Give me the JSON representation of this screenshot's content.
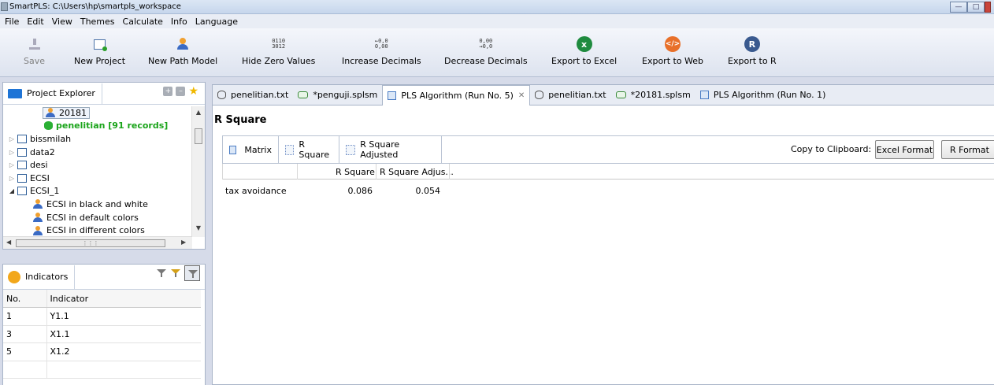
{
  "window": {
    "title": "SmartPLS: C:\\Users\\hp\\smartpls_workspace"
  },
  "menu": [
    "File",
    "Edit",
    "View",
    "Themes",
    "Calculate",
    "Info",
    "Language"
  ],
  "toolbar": {
    "save": "Save",
    "new_project": "New Project",
    "new_path_model": "New Path Model",
    "hide_zero": "Hide Zero Values",
    "hide_zero_glyph": "0110\n3012",
    "increase_decimals": "Increase Decimals",
    "increase_glyph": "←0,0\n0,00",
    "decrease_decimals": "Decrease Decimals",
    "decrease_glyph": "0,00\n→0,0",
    "export_excel": "Export to Excel",
    "export_web": "Export to Web",
    "export_r": "Export to R",
    "excel_glyph": "x",
    "web_glyph": "</>",
    "r_glyph": "R"
  },
  "project_explorer": {
    "title": "Project Explorer",
    "items": [
      {
        "label": "20181",
        "type": "path-model",
        "selected": true
      },
      {
        "label": "penelitian [91 records]",
        "type": "dataset"
      },
      {
        "label": "bissmilah",
        "type": "project"
      },
      {
        "label": "data2",
        "type": "project"
      },
      {
        "label": "desi",
        "type": "project"
      },
      {
        "label": "ECSI",
        "type": "project"
      },
      {
        "label": "ECSI_1",
        "type": "project",
        "expanded": true
      },
      {
        "label": "ECSI in black and white",
        "type": "path-model"
      },
      {
        "label": "ECSI in default colors",
        "type": "path-model"
      },
      {
        "label": "ECSI in different colors",
        "type": "path-model"
      }
    ]
  },
  "indicators": {
    "title": "Indicators",
    "col_no": "No.",
    "col_indicator": "Indicator",
    "rows": [
      {
        "no": "1",
        "name": "Y1.1"
      },
      {
        "no": "3",
        "name": "X1.1"
      },
      {
        "no": "5",
        "name": "X1.2"
      }
    ]
  },
  "editor_tabs": [
    {
      "label": "penelitian.txt",
      "icon": "database-icon"
    },
    {
      "label": "*penguji.splsm",
      "icon": "model-icon"
    },
    {
      "label": "PLS Algorithm (Run No. 5)",
      "icon": "table-icon",
      "active": true,
      "close": "✕"
    },
    {
      "label": "penelitian.txt",
      "icon": "database-icon"
    },
    {
      "label": "*20181.splsm",
      "icon": "model-icon"
    },
    {
      "label": "PLS Algorithm (Run No. 1)",
      "icon": "table-icon"
    }
  ],
  "report": {
    "title": "R Square",
    "subtabs": [
      "Matrix",
      "R Square",
      "R Square Adjusted"
    ],
    "copy_label": "Copy to Clipboard:",
    "excel_format": "Excel Format",
    "r_format": "R Format",
    "columns": [
      "R Square",
      "R Square Adjus..."
    ],
    "rows": [
      {
        "label": "tax avoidance",
        "r_square": "0.086",
        "r_square_adj": "0.054"
      }
    ]
  }
}
